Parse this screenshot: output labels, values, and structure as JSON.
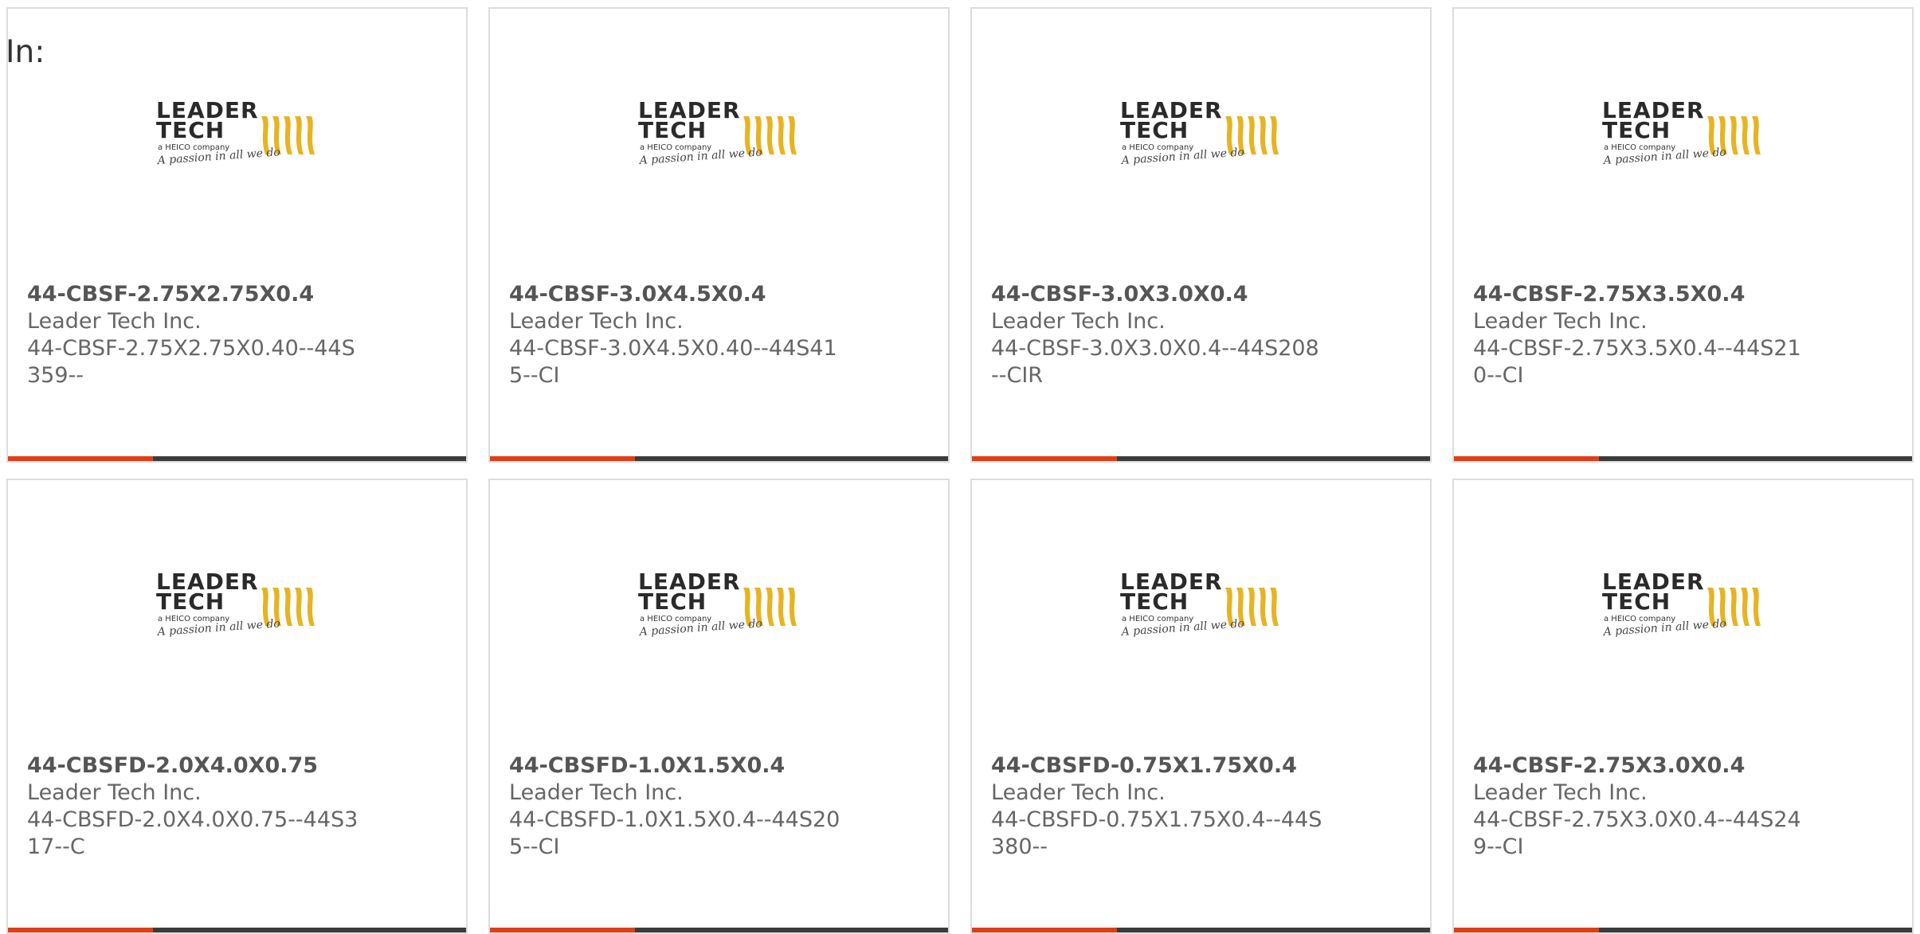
{
  "header": {
    "in_label": "In:"
  },
  "colors": {
    "accent": "#e43d12",
    "bar": "#3b3b3b",
    "border": "#dddddd",
    "text": "#555555"
  },
  "logo": {
    "line1": "LEADER",
    "line2": "TECH",
    "tagline": "a HEICO company",
    "slogan": "A passion in all we do"
  },
  "products": [
    {
      "part_number": "44-CBSF-2.75X2.75X0.4",
      "manufacturer": "Leader Tech Inc.",
      "description": "44-CBSF-2.75X2.75X0.40--44S359--"
    },
    {
      "part_number": "44-CBSF-3.0X4.5X0.4",
      "manufacturer": "Leader Tech Inc.",
      "description": "44-CBSF-3.0X4.5X0.40--44S415--CI"
    },
    {
      "part_number": "44-CBSF-3.0X3.0X0.4",
      "manufacturer": "Leader Tech Inc.",
      "description": "44-CBSF-3.0X3.0X0.4--44S208--CIR"
    },
    {
      "part_number": "44-CBSF-2.75X3.5X0.4",
      "manufacturer": "Leader Tech Inc.",
      "description": "44-CBSF-2.75X3.5X0.4--44S210--CI"
    },
    {
      "part_number": "44-CBSFD-2.0X4.0X0.75",
      "manufacturer": "Leader Tech Inc.",
      "description": "44-CBSFD-2.0X4.0X0.75--44S317--C"
    },
    {
      "part_number": "44-CBSFD-1.0X1.5X0.4",
      "manufacturer": "Leader Tech Inc.",
      "description": "44-CBSFD-1.0X1.5X0.4--44S205--CI"
    },
    {
      "part_number": "44-CBSFD-0.75X1.75X0.4",
      "manufacturer": "Leader Tech Inc.",
      "description": "44-CBSFD-0.75X1.75X0.4--44S380--"
    },
    {
      "part_number": "44-CBSF-2.75X3.0X0.4",
      "manufacturer": "Leader Tech Inc.",
      "description": "44-CBSF-2.75X3.0X0.4--44S249--CI"
    }
  ]
}
